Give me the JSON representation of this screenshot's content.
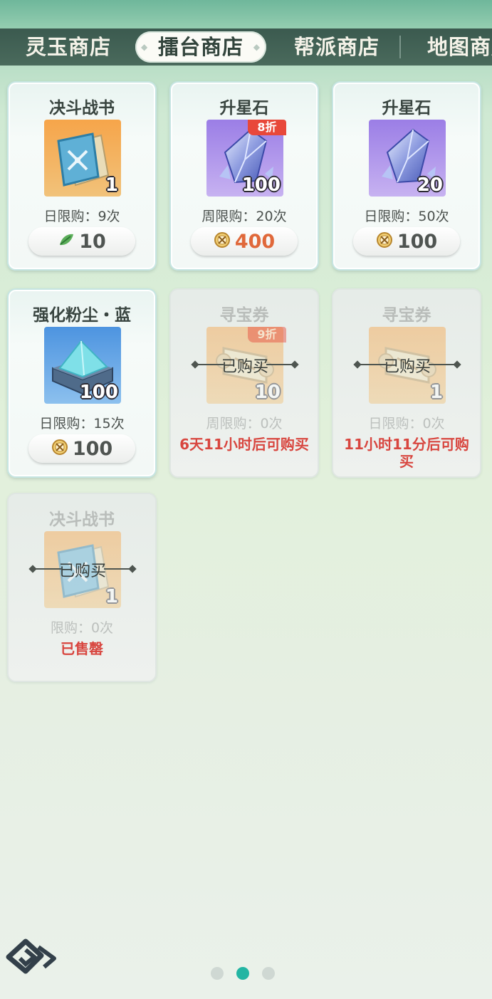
{
  "tabs": [
    {
      "label": "灵玉商店",
      "active": false
    },
    {
      "label": "擂台商店",
      "active": true
    },
    {
      "label": "帮派商店",
      "active": false
    },
    {
      "label": "地图商店",
      "active": false
    }
  ],
  "cards": [
    {
      "title": "决斗战书",
      "icon": "battle-scroll-icon",
      "quantity": "1",
      "discount": "",
      "limit": "日限购：9次",
      "currency_icon": "leaf-currency-icon",
      "price": "10",
      "state": "available",
      "status": ""
    },
    {
      "title": "升星石",
      "icon": "star-stone-icon",
      "quantity": "100",
      "discount": "8折",
      "limit": "周限购：20次",
      "currency_icon": "arena-coin-icon",
      "price": "400",
      "state": "available",
      "status": ""
    },
    {
      "title": "升星石",
      "icon": "star-stone-icon",
      "quantity": "20",
      "discount": "",
      "limit": "日限购：50次",
      "currency_icon": "arena-coin-icon",
      "price": "100",
      "state": "available",
      "status": ""
    },
    {
      "title": "强化粉尘・蓝",
      "icon": "blue-dust-icon",
      "quantity": "100",
      "discount": "",
      "limit": "日限购：15次",
      "currency_icon": "arena-coin-icon",
      "price": "100",
      "state": "available",
      "status": ""
    },
    {
      "title": "寻宝券",
      "icon": "treasure-ticket-icon",
      "quantity": "10",
      "discount": "9折",
      "limit": "周限购：0次",
      "currency_icon": "",
      "price": "",
      "state": "bought",
      "bought_label": "已购买",
      "status": "6天11小时后可购买"
    },
    {
      "title": "寻宝券",
      "icon": "treasure-ticket-icon",
      "quantity": "1",
      "discount": "",
      "limit": "日限购：0次",
      "currency_icon": "",
      "price": "",
      "state": "bought",
      "bought_label": "已购买",
      "status": "11小时11分后可购买"
    },
    {
      "title": "决斗战书",
      "icon": "battle-scroll-icon",
      "quantity": "1",
      "discount": "",
      "limit": "限购：0次",
      "currency_icon": "",
      "price": "",
      "state": "bought",
      "bought_label": "已购买",
      "status": "已售罄"
    }
  ],
  "pagination": {
    "count": 3,
    "active_index": 1
  },
  "colors": {
    "accent": "#23b5a3",
    "discount_badge": "#e8483a",
    "status_red": "#d8463f",
    "discount_price": "#e0683a"
  }
}
